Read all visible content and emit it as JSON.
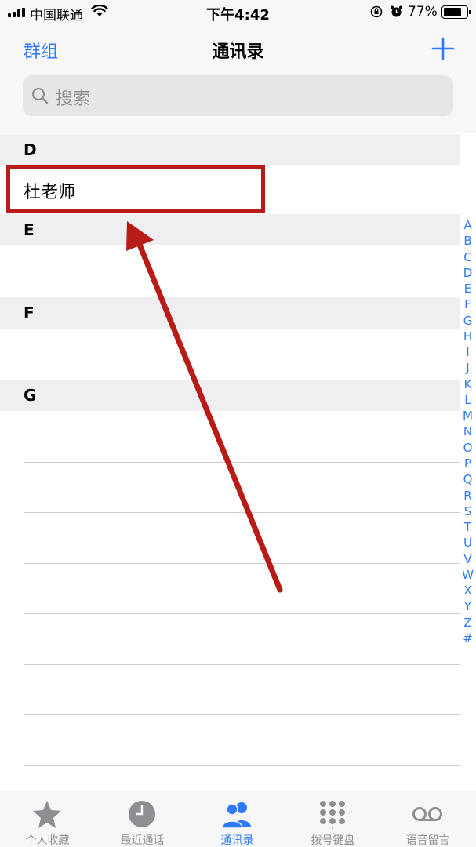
{
  "status_bar": {
    "carrier": "中国联通",
    "time": "下午4:42",
    "battery_percent": "77%",
    "battery_level": 0.77
  },
  "nav": {
    "left_label": "群组",
    "title": "通讯录",
    "add_icon": "plus-icon"
  },
  "search": {
    "placeholder": "搜索",
    "icon": "search-icon"
  },
  "sections": [
    {
      "letter": "D",
      "contacts": [
        "杜老师"
      ]
    },
    {
      "letter": "E",
      "contacts": []
    },
    {
      "letter": "F",
      "contacts": []
    },
    {
      "letter": "G",
      "contacts": []
    }
  ],
  "index_letters": [
    "A",
    "B",
    "C",
    "D",
    "E",
    "F",
    "G",
    "H",
    "I",
    "J",
    "K",
    "L",
    "M",
    "N",
    "O",
    "P",
    "Q",
    "R",
    "S",
    "T",
    "U",
    "V",
    "W",
    "X",
    "Y",
    "Z",
    "#"
  ],
  "tabs": [
    {
      "label": "个人收藏",
      "icon": "star-icon",
      "active": false
    },
    {
      "label": "最近通话",
      "icon": "clock-icon",
      "active": false
    },
    {
      "label": "通讯录",
      "icon": "people-icon",
      "active": true
    },
    {
      "label": "拨号键盘",
      "icon": "keypad-icon",
      "active": false
    },
    {
      "label": "语音留言",
      "icon": "voicemail-icon",
      "active": false
    }
  ],
  "colors": {
    "accent": "#2f7bf6",
    "annotation": "#b81c18"
  }
}
